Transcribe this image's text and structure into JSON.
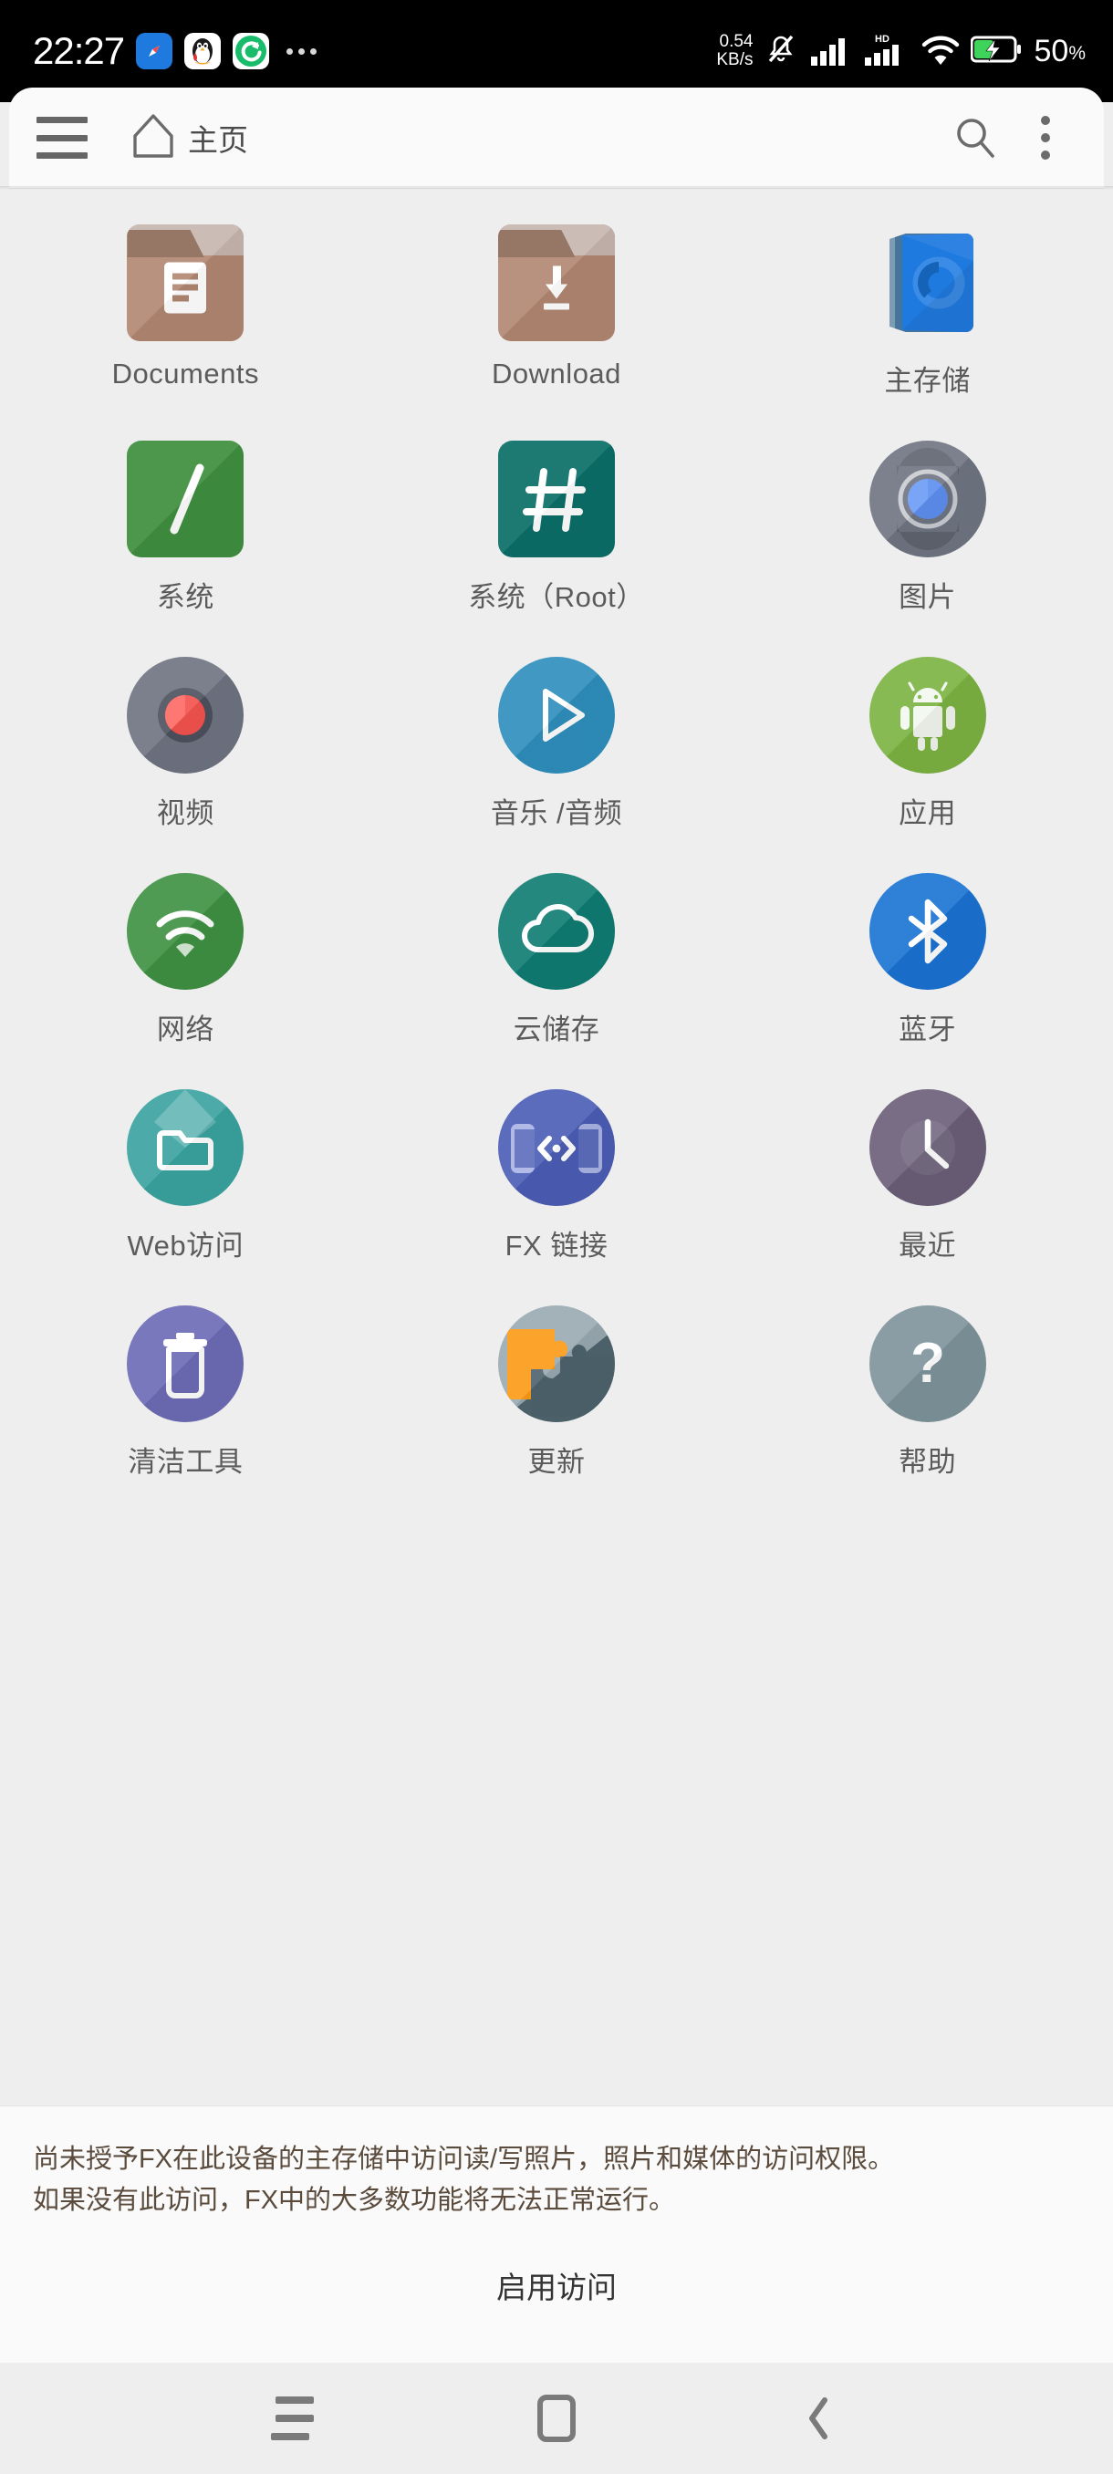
{
  "status_bar": {
    "time": "22:27",
    "app_icons": [
      "browser-icon",
      "qq-penguin-icon",
      "sync-icon"
    ],
    "overflow": "more-icons",
    "net_speed_value": "0.54",
    "net_speed_unit": "KB/s",
    "mute_icon": "bell-muted-icon",
    "signal_1": "signal-bars-icon",
    "signal_2": "signal-bars-hd-icon",
    "hd_label": "HD",
    "wifi_icon": "wifi-icon",
    "battery_icon": "battery-charging-icon",
    "battery_level": "50",
    "battery_percent_sign": "%"
  },
  "app_bar": {
    "menu_icon": "hamburger-menu-icon",
    "home_icon": "home-icon",
    "title": "主页",
    "search_icon": "search-icon",
    "overflow_icon": "more-vertical-icon"
  },
  "colors": {
    "background": "#eeeeee",
    "app_bar": "#fafafa",
    "label_text": "#5b5b5b",
    "permission_text": "#5a4b3c",
    "folder_brown": "#b08670",
    "system_green": "#3f8f3f",
    "system_root_teal": "#0b7068",
    "storage_blue": "#1f7ae0",
    "pictures_gray": "#6f7582",
    "video_gray": "#6f7482",
    "music_blue": "#2e8fbd",
    "apps_green": "#7cb342",
    "network_green": "#3e9142",
    "cloud_teal": "#0f7c72",
    "bluetooth_blue": "#1a73d3",
    "web_teal": "#3aa3a0",
    "fxlink_indigo": "#4c5db5",
    "recent_purple": "#6b5f79",
    "clean_purple": "#6d6bb5",
    "update_orange": "#fb9a16",
    "help_gray": "#7e939b"
  },
  "grid": {
    "items": [
      {
        "label": "Documents",
        "icon": "folder-documents-icon",
        "shape": "folder"
      },
      {
        "label": "Download",
        "icon": "folder-download-icon",
        "shape": "folder"
      },
      {
        "label": "主存储",
        "icon": "main-storage-drive-icon",
        "shape": "drive"
      },
      {
        "label": "系统",
        "icon": "system-root-slash-icon",
        "shape": "square"
      },
      {
        "label": "系统（Root）",
        "icon": "system-root-hash-icon",
        "shape": "square"
      },
      {
        "label": "图片",
        "icon": "pictures-camera-icon",
        "shape": "circle"
      },
      {
        "label": "视频",
        "icon": "video-record-icon",
        "shape": "circle"
      },
      {
        "label": "音乐 /音频",
        "icon": "music-play-icon",
        "shape": "circle"
      },
      {
        "label": "应用",
        "icon": "apps-android-icon",
        "shape": "circle"
      },
      {
        "label": "网络",
        "icon": "network-wifi-icon",
        "shape": "circle"
      },
      {
        "label": "云储存",
        "icon": "cloud-storage-icon",
        "shape": "circle"
      },
      {
        "label": "蓝牙",
        "icon": "bluetooth-icon",
        "shape": "circle"
      },
      {
        "label": "Web访问",
        "icon": "web-access-folder-icon",
        "shape": "circle"
      },
      {
        "label": "FX 链接",
        "icon": "fx-link-devices-icon",
        "shape": "circle"
      },
      {
        "label": "最近",
        "icon": "recent-clock-icon",
        "shape": "circle"
      },
      {
        "label": "清洁工具",
        "icon": "clean-tools-trash-icon",
        "shape": "circle"
      },
      {
        "label": "更新",
        "icon": "update-puzzle-icon",
        "shape": "circle"
      },
      {
        "label": "帮助",
        "icon": "help-question-icon",
        "shape": "circle"
      }
    ]
  },
  "permission_banner": {
    "line1": "尚未授予FX在此设备的主存储中访问读/写照片，照片和媒体的访问权限。",
    "line2": "如果没有此访问，FX中的大多数功能将无法正常运行。",
    "button": "启用访问"
  },
  "nav_bar": {
    "recents": "recents-icon",
    "home": "home-square-icon",
    "back": "back-chevron-icon"
  }
}
